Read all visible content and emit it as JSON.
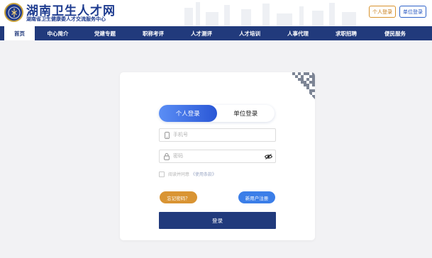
{
  "header": {
    "title": "湖南卫生人才网",
    "subtitle": "湖南省卫生健康委人才交流服务中心",
    "personal_login": "个人登录",
    "unit_login": "单位登录"
  },
  "nav": {
    "items": [
      {
        "label": "首页",
        "active": true
      },
      {
        "label": "中心简介",
        "active": false
      },
      {
        "label": "党建专题",
        "active": false
      },
      {
        "label": "职称考评",
        "active": false
      },
      {
        "label": "人才测评",
        "active": false
      },
      {
        "label": "人才培训",
        "active": false
      },
      {
        "label": "人事代理",
        "active": false
      },
      {
        "label": "求职招聘",
        "active": false
      },
      {
        "label": "便民服务",
        "active": false
      }
    ]
  },
  "login": {
    "tabs": {
      "personal": "个人登录",
      "unit": "单位登录"
    },
    "phone_placeholder": "手机号",
    "password_placeholder": "密码",
    "agree_text": "阅读并同意",
    "terms_text": "《使用条款》",
    "forgot_label": "忘记密码？",
    "register_label": "新用户注册",
    "submit_label": "登录"
  },
  "icons": {
    "logo": "emblem-icon",
    "qr": "qr-code-icon",
    "phone": "phone-icon",
    "lock": "lock-icon",
    "eye": "eye-slash-icon"
  },
  "colors": {
    "brand": "#213a7c",
    "accent_orange": "#d99433",
    "accent_blue": "#3b7ee8"
  }
}
